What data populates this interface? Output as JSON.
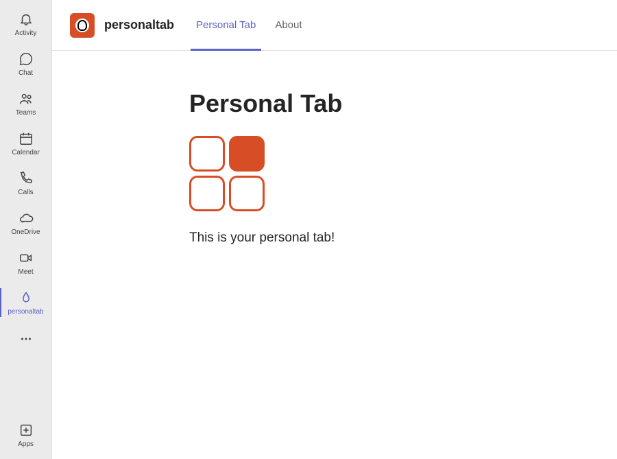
{
  "rail": {
    "items": [
      {
        "label": "Activity"
      },
      {
        "label": "Chat"
      },
      {
        "label": "Teams"
      },
      {
        "label": "Calendar"
      },
      {
        "label": "Calls"
      },
      {
        "label": "OneDrive"
      },
      {
        "label": "Meet"
      },
      {
        "label": "personaltab"
      }
    ],
    "apps_label": "Apps"
  },
  "header": {
    "app_title": "personaltab",
    "tabs": [
      {
        "label": "Personal Tab"
      },
      {
        "label": "About"
      }
    ],
    "active_tab_index": 0
  },
  "content": {
    "title": "Personal Tab",
    "body": "This is your personal tab!"
  },
  "colors": {
    "accent": "#5b5fc7",
    "brand": "#d64d26"
  }
}
